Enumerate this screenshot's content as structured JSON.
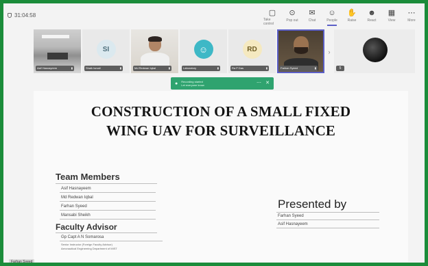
{
  "meeting": {
    "timer": "31:04:58"
  },
  "toolbar": [
    {
      "id": "share",
      "label": "Take control",
      "icon": "▢"
    },
    {
      "id": "leave-share",
      "label": "Pop out",
      "icon": "⊙"
    },
    {
      "id": "chat",
      "label": "Chat",
      "icon": "✉"
    },
    {
      "id": "people",
      "label": "People",
      "icon": "☺"
    },
    {
      "id": "raise",
      "label": "Raise",
      "icon": "✋"
    },
    {
      "id": "react",
      "label": "React",
      "icon": "☻"
    },
    {
      "id": "view",
      "label": "View",
      "icon": "▦"
    },
    {
      "id": "more",
      "label": "More",
      "icon": "⋯"
    }
  ],
  "participants": [
    {
      "name": "Asif Hasnayeem",
      "initials": "",
      "kind": "classroom"
    },
    {
      "name": "Shaik Ismail",
      "initials": "SI",
      "kind": "avatar-si"
    },
    {
      "name": "Md Redwan Iqbal",
      "initials": "",
      "kind": "cam1"
    },
    {
      "name": "Laboratory",
      "initials": "",
      "kind": "avatar-person"
    },
    {
      "name": "Ra P Das",
      "initials": "RD",
      "kind": "avatar-rd"
    },
    {
      "name": "Farhan Syeed",
      "initials": "",
      "kind": "cam2"
    },
    {
      "name": "",
      "initials": "",
      "kind": "last"
    }
  ],
  "more_count": "5",
  "toast": {
    "line1": "Recording started",
    "line2": "Let everyone know"
  },
  "slide": {
    "title_line1": "CONSTRUCTION OF A SMALL FIXED",
    "title_line2": "WING UAV FOR SURVEILLANCE",
    "team_heading": "Team Members",
    "team": [
      "Asif Hasnayeem",
      "Md Redwan Iqbal",
      "Farhan Syeed",
      "Mansabi Sheikh"
    ],
    "faculty_heading": "Faculty Advisor",
    "advisor": "Gp Capt A N Somarosa",
    "advisor_role1": "Senior Instructor (Foreign Faculty Advisor)",
    "advisor_role2": "Aeronautical Engineering Department of MIST",
    "presented_heading": "Presented by",
    "presenters": [
      "Farhan Syeed",
      "Asif Hasnayeem"
    ]
  },
  "presenter_caption": "Farhan Syeed",
  "colors": {
    "frame": "#1b8c3a",
    "accent": "#5b5fc7",
    "toast": "#2fa36f"
  }
}
